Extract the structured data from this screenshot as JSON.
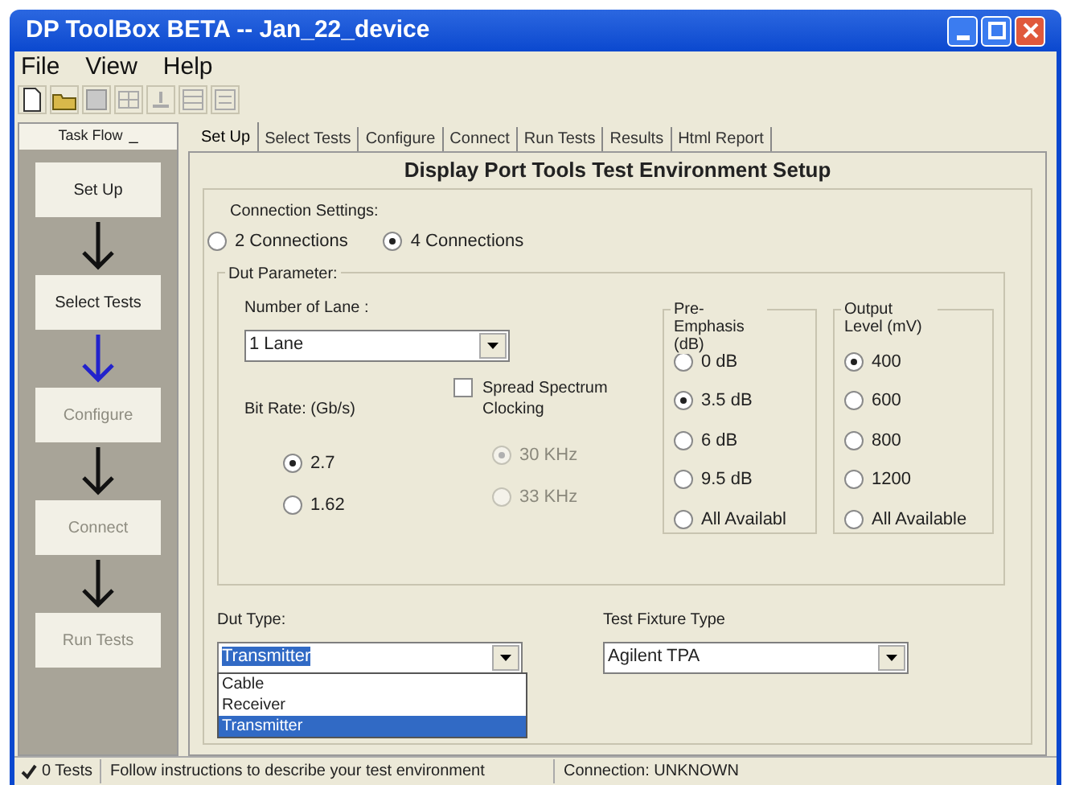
{
  "window": {
    "title": "DP ToolBox BETA -- Jan_22_device"
  },
  "menu": [
    "File",
    "View",
    "Help"
  ],
  "task_flow": {
    "title": "Task Flow",
    "collapse": "_",
    "steps": [
      {
        "label": "Set Up",
        "enabled": true
      },
      {
        "label": "Select Tests",
        "enabled": true
      },
      {
        "label": "Configure",
        "enabled": false
      },
      {
        "label": "Connect",
        "enabled": false
      },
      {
        "label": "Run Tests",
        "enabled": false
      }
    ],
    "arrows": [
      {
        "highlighted": false
      },
      {
        "highlighted": true
      },
      {
        "highlighted": false
      },
      {
        "highlighted": false
      }
    ]
  },
  "tabs": [
    {
      "label": "Set Up",
      "selected": true
    },
    {
      "label": "Select Tests",
      "selected": false
    },
    {
      "label": "Configure",
      "selected": false
    },
    {
      "label": "Connect",
      "selected": false
    },
    {
      "label": "Run Tests",
      "selected": false
    },
    {
      "label": "Results",
      "selected": false
    },
    {
      "label": "Html Report",
      "selected": false
    }
  ],
  "heading": "Display Port Tools Test Environment Setup",
  "connection_settings": {
    "label": "Connection Settings:",
    "options": [
      {
        "label": "2 Connections",
        "selected": false
      },
      {
        "label": "4 Connections",
        "selected": true
      }
    ]
  },
  "dut_parameter": {
    "label": "Dut Parameter:",
    "lanes": {
      "label": "Number of Lane :",
      "value": "1 Lane"
    },
    "bit_rate": {
      "label": "Bit Rate: (Gb/s)",
      "options": [
        {
          "label": "2.7",
          "selected": true
        },
        {
          "label": "1.62",
          "selected": false
        }
      ]
    },
    "spread_spectrum": {
      "label": "Spread Spectrum Clocking",
      "checked": false,
      "options": [
        {
          "label": "30 KHz",
          "selected": true,
          "disabled": true
        },
        {
          "label": "33 KHz",
          "selected": false,
          "disabled": true
        }
      ]
    },
    "pre_emphasis": {
      "label": "Pre-Emphasis (dB)",
      "options": [
        {
          "label": "0 dB",
          "selected": false
        },
        {
          "label": "3.5 dB",
          "selected": true
        },
        {
          "label": "6 dB",
          "selected": false
        },
        {
          "label": "9.5 dB",
          "selected": false
        },
        {
          "label": "All Availabl",
          "selected": false
        }
      ]
    },
    "output_level": {
      "label": "Output Level (mV)",
      "options": [
        {
          "label": "400",
          "selected": true
        },
        {
          "label": "600",
          "selected": false
        },
        {
          "label": "800",
          "selected": false
        },
        {
          "label": "1200",
          "selected": false
        },
        {
          "label": "All Available",
          "selected": false
        }
      ]
    }
  },
  "dut_type": {
    "label": "Dut Type:",
    "value": "Transmitter",
    "options": [
      {
        "label": "Cable",
        "selected": false
      },
      {
        "label": "Receiver",
        "selected": false
      },
      {
        "label": "Transmitter",
        "selected": true
      }
    ]
  },
  "test_fixture": {
    "label": "Test Fixture Type",
    "value": "Agilent TPA"
  },
  "status_bar": {
    "tests": "0 Tests",
    "tests_checked": true,
    "message": "Follow instructions to describe your test environment",
    "connection": "Connection: UNKNOWN"
  }
}
